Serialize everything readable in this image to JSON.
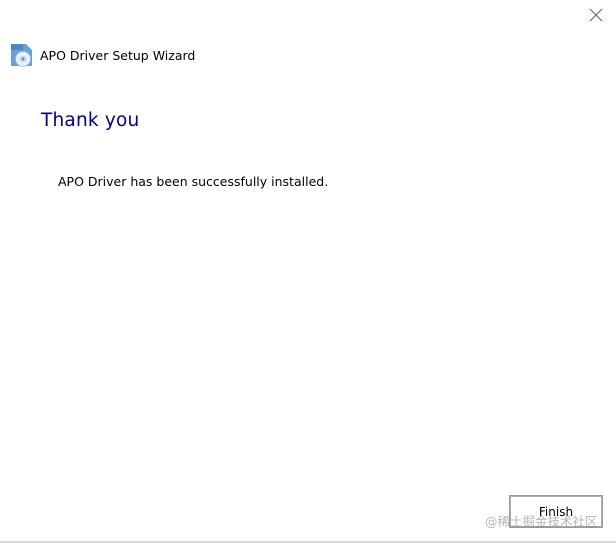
{
  "window": {
    "title": "APO Driver Setup Wizard",
    "close_icon": "close-icon",
    "app_icon": "disc-installer-icon"
  },
  "page": {
    "heading": "Thank you",
    "message": "APO Driver has been successfully installed."
  },
  "buttons": {
    "finish_label": "Finish"
  },
  "watermark": {
    "text": "@稀土掘金技术社区"
  },
  "colors": {
    "heading": "#000080",
    "background": "#ffffff"
  }
}
